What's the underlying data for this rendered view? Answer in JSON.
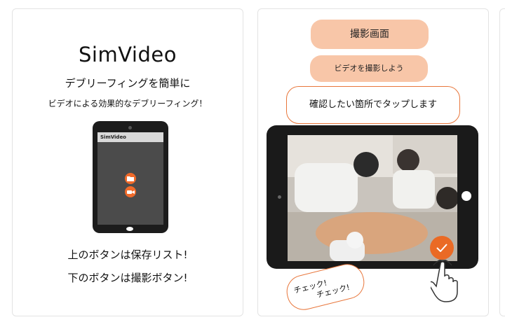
{
  "left_card": {
    "logo": "SimVideo",
    "tagline": "デブリーフィングを簡単に",
    "subtagline": "ビデオによる効果的なデブリーフィング！",
    "tablet_title": "SimVideo",
    "note_top": "上のボタンは保存リスト!",
    "note_bottom": "下のボタンは撮影ボタン!"
  },
  "right_card": {
    "screen_label": "撮影画面",
    "record_label": "ビデオを撮影しよう",
    "tap_hint": "確認したい箇所でタップします",
    "check_1": "チェック!",
    "check_2": "チェック!"
  },
  "colors": {
    "accent": "#f06a2a",
    "pill": "#f8c6a8",
    "tablet": "#1c1c1c"
  },
  "icons": [
    "folder-icon",
    "video-camera-icon",
    "checkmark-icon",
    "hand-pointer-icon"
  ]
}
